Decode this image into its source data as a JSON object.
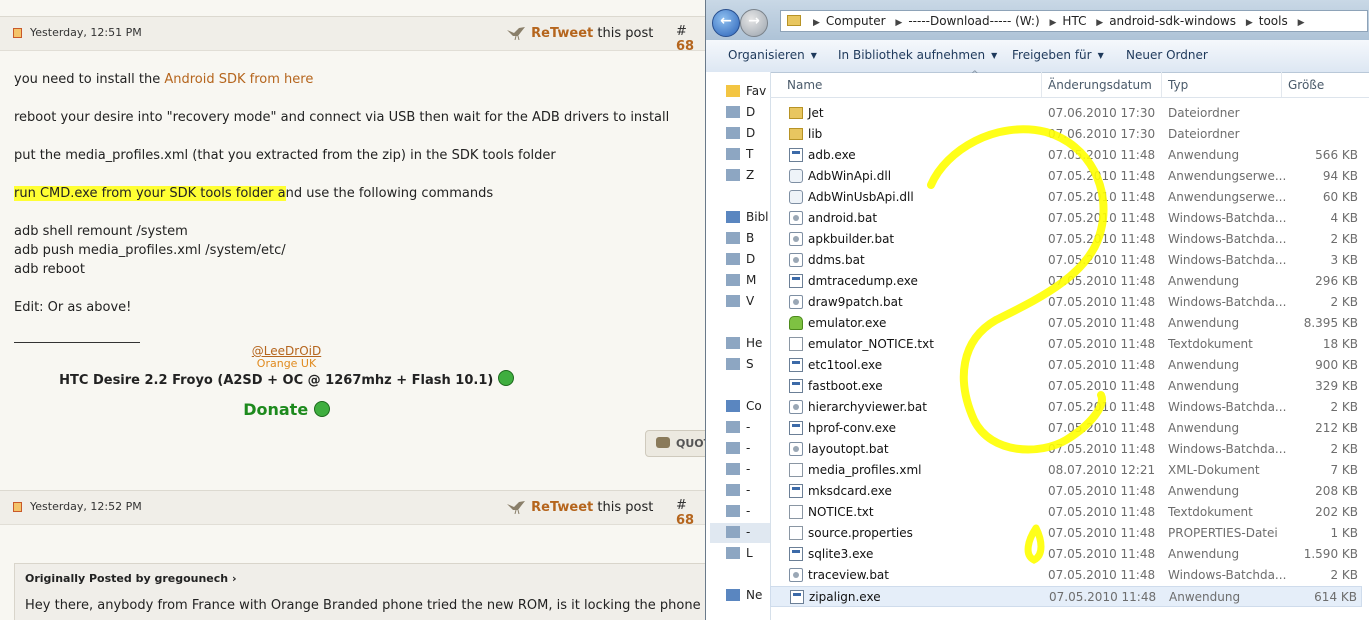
{
  "forum": {
    "post1": {
      "date": "Yesterday, 12:51 PM",
      "retweet_word": "ReTweet",
      "retweet_suffix": "this post",
      "post_prefix": "#",
      "post_number": "68",
      "lines": {
        "l1_pre": "you need to install the ",
        "l1_link": "Android SDK from here",
        "l2": "reboot your desire into \"recovery mode\" and connect via USB then wait for the ADB drivers to install",
        "l3": "put the media_profiles.xml (that you extracted from the zip) in the SDK tools folder",
        "l4_highlight": "run CMD.exe from your SDK tools folder a",
        "l4_rest": "nd use the following commands",
        "cmd1": "adb shell remount /system",
        "cmd2": "adb push media_profiles.xml /system/etc/",
        "cmd3": "adb reboot",
        "edit": "Edit: Or as above!"
      },
      "signature": {
        "link": "@LeeDrOiD",
        "sub": "Orange UK",
        "main": "HTC Desire 2.2 Froyo (A2SD + OC @ 1267mhz + Flash 10.1)",
        "donate": "Donate"
      },
      "quote_button": "QUOTE"
    },
    "post2": {
      "date": "Yesterday, 12:52 PM",
      "retweet_word": "ReTweet",
      "retweet_suffix": "this post",
      "post_prefix": "#",
      "post_number": "68",
      "quote_header": "Originally Posted by gregounech",
      "quote_text": "Hey there, anybody from France with Orange Branded phone tried the new ROM, is it locking the phone"
    }
  },
  "explorer": {
    "breadcrumbs": [
      "Computer",
      "-----Download----- (W:)",
      "HTC",
      "android-sdk-windows",
      "tools"
    ],
    "toolbar": {
      "organize": "Organisieren",
      "library": "In Bibliothek aufnehmen",
      "share": "Freigeben für",
      "new_folder": "Neuer Ordner"
    },
    "nav_items": [
      "Fav",
      "D",
      "D",
      "T",
      "Z",
      "Bibl",
      "B",
      "D",
      "M",
      "V",
      "He",
      "S",
      "Co",
      "-",
      "-",
      "-",
      "-",
      "-",
      "-",
      "L",
      "Ne"
    ],
    "columns": {
      "name": "Name",
      "date": "Änderungsdatum",
      "type": "Typ",
      "size": "Größe"
    },
    "files": [
      {
        "name": "Jet",
        "date": "07.06.2010 17:30",
        "type": "Dateiordner",
        "size": "",
        "icon": "folder-icon"
      },
      {
        "name": "lib",
        "date": "07.06.2010 17:30",
        "type": "Dateiordner",
        "size": "",
        "icon": "folder-icon"
      },
      {
        "name": "adb.exe",
        "date": "07.05.2010 11:48",
        "type": "Anwendung",
        "size": "566 KB",
        "icon": "exe-icon"
      },
      {
        "name": "AdbWinApi.dll",
        "date": "07.05.2010 11:48",
        "type": "Anwendungserwe...",
        "size": "94 KB",
        "icon": "dll-icon"
      },
      {
        "name": "AdbWinUsbApi.dll",
        "date": "07.05.2010 11:48",
        "type": "Anwendungserwe...",
        "size": "60 KB",
        "icon": "dll-icon"
      },
      {
        "name": "android.bat",
        "date": "07.05.2010 11:48",
        "type": "Windows-Batchda...",
        "size": "4 KB",
        "icon": "bat-icon"
      },
      {
        "name": "apkbuilder.bat",
        "date": "07.05.2010 11:48",
        "type": "Windows-Batchda...",
        "size": "2 KB",
        "icon": "bat-icon"
      },
      {
        "name": "ddms.bat",
        "date": "07.05.2010 11:48",
        "type": "Windows-Batchda...",
        "size": "3 KB",
        "icon": "bat-icon"
      },
      {
        "name": "dmtracedump.exe",
        "date": "07.05.2010 11:48",
        "type": "Anwendung",
        "size": "296 KB",
        "icon": "exe-icon"
      },
      {
        "name": "draw9patch.bat",
        "date": "07.05.2010 11:48",
        "type": "Windows-Batchda...",
        "size": "2 KB",
        "icon": "bat-icon"
      },
      {
        "name": "emulator.exe",
        "date": "07.05.2010 11:48",
        "type": "Anwendung",
        "size": "8.395 KB",
        "icon": "android-icon"
      },
      {
        "name": "emulator_NOTICE.txt",
        "date": "07.05.2010 11:48",
        "type": "Textdokument",
        "size": "18 KB",
        "icon": "txt-icon"
      },
      {
        "name": "etc1tool.exe",
        "date": "07.05.2010 11:48",
        "type": "Anwendung",
        "size": "900 KB",
        "icon": "exe-icon"
      },
      {
        "name": "fastboot.exe",
        "date": "07.05.2010 11:48",
        "type": "Anwendung",
        "size": "329 KB",
        "icon": "exe-icon"
      },
      {
        "name": "hierarchyviewer.bat",
        "date": "07.05.2010 11:48",
        "type": "Windows-Batchda...",
        "size": "2 KB",
        "icon": "bat-icon"
      },
      {
        "name": "hprof-conv.exe",
        "date": "07.05.2010 11:48",
        "type": "Anwendung",
        "size": "212 KB",
        "icon": "exe-icon"
      },
      {
        "name": "layoutopt.bat",
        "date": "07.05.2010 11:48",
        "type": "Windows-Batchda...",
        "size": "2 KB",
        "icon": "bat-icon"
      },
      {
        "name": "media_profiles.xml",
        "date": "08.07.2010 12:21",
        "type": "XML-Dokument",
        "size": "7 KB",
        "icon": "xml-icon"
      },
      {
        "name": "mksdcard.exe",
        "date": "07.05.2010 11:48",
        "type": "Anwendung",
        "size": "208 KB",
        "icon": "exe-icon"
      },
      {
        "name": "NOTICE.txt",
        "date": "07.05.2010 11:48",
        "type": "Textdokument",
        "size": "202 KB",
        "icon": "txt-icon"
      },
      {
        "name": "source.properties",
        "date": "07.05.2010 11:48",
        "type": "PROPERTIES-Datei",
        "size": "1 KB",
        "icon": "txt-icon"
      },
      {
        "name": "sqlite3.exe",
        "date": "07.05.2010 11:48",
        "type": "Anwendung",
        "size": "1.590 KB",
        "icon": "exe-icon"
      },
      {
        "name": "traceview.bat",
        "date": "07.05.2010 11:48",
        "type": "Windows-Batchda...",
        "size": "2 KB",
        "icon": "bat-icon"
      },
      {
        "name": "zipalign.exe",
        "date": "07.05.2010 11:48",
        "type": "Anwendung",
        "size": "614 KB",
        "icon": "exe-icon",
        "selected": true
      }
    ],
    "highlight_color": "#ffff00"
  }
}
